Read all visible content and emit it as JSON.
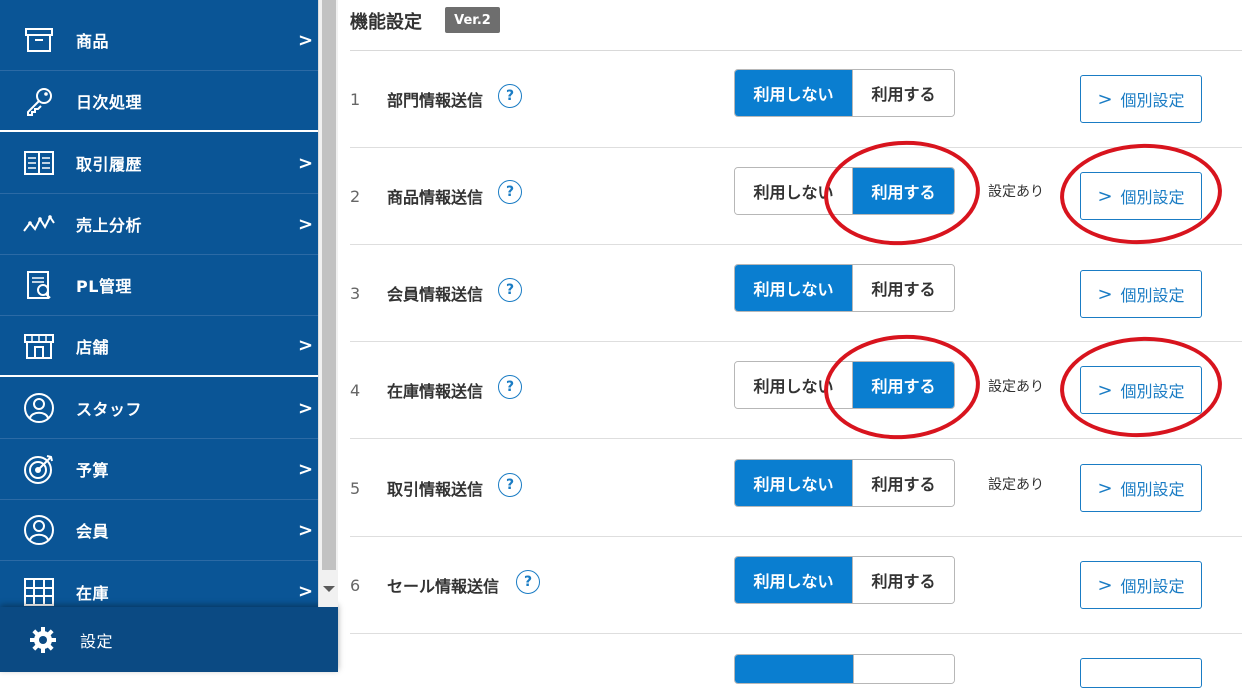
{
  "sidebar": {
    "items": [
      {
        "label": "商品",
        "icon": "box-icon",
        "chevron": true
      },
      {
        "label": "日次処理",
        "icon": "key-icon",
        "chevron": false
      },
      {
        "label": "取引履歴",
        "icon": "ledger-icon",
        "chevron": true
      },
      {
        "label": "売上分析",
        "icon": "trend-line-icon",
        "chevron": true
      },
      {
        "label": "PL管理",
        "icon": "report-icon",
        "chevron": false
      },
      {
        "label": "店舗",
        "icon": "store-icon",
        "chevron": true
      },
      {
        "label": "スタッフ",
        "icon": "staff-icon",
        "chevron": true
      },
      {
        "label": "予算",
        "icon": "target-icon",
        "chevron": true
      },
      {
        "label": "会員",
        "icon": "member-icon",
        "chevron": true
      },
      {
        "label": "在庫",
        "icon": "inventory-icon",
        "chevron": true
      }
    ],
    "chevron_glyph": ">",
    "settings": {
      "label": "設定",
      "icon": "gear-icon"
    }
  },
  "main": {
    "title": "機能設定",
    "version_badge": "Ver.2",
    "help_glyph": "?",
    "toggle_labels": {
      "off": "利用しない",
      "on": "利用する"
    },
    "individual_button_label": "個別設定",
    "individual_button_chevron": ">",
    "rows": [
      {
        "num": "1",
        "name": "部門情報送信",
        "selected": "off",
        "status": ""
      },
      {
        "num": "2",
        "name": "商品情報送信",
        "selected": "on",
        "status": "設定あり"
      },
      {
        "num": "3",
        "name": "会員情報送信",
        "selected": "off",
        "status": ""
      },
      {
        "num": "4",
        "name": "在庫情報送信",
        "selected": "on",
        "status": "設定あり"
      },
      {
        "num": "5",
        "name": "取引情報送信",
        "selected": "off",
        "status": "設定あり"
      },
      {
        "num": "6",
        "name": "セール情報送信",
        "selected": "off",
        "status": ""
      }
    ]
  },
  "colors": {
    "sidebar_bg": "#0a5596",
    "active_toggle": "#0a7ed0",
    "link_blue": "#1a7cc4",
    "highlight_red": "#d8141e"
  }
}
